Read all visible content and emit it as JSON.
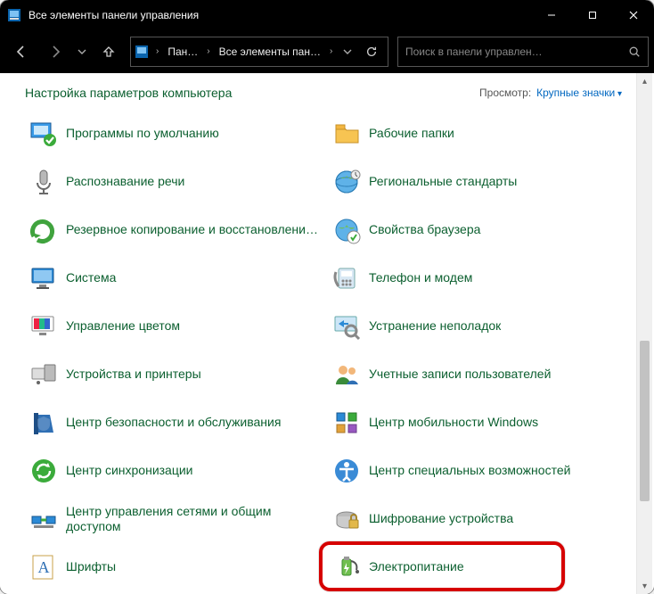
{
  "titlebar": {
    "title": "Все элементы панели управления"
  },
  "breadcrumb": {
    "seg1": "Пан…",
    "seg2": "Все элементы пан…"
  },
  "search": {
    "placeholder": "Поиск в панели управлен…"
  },
  "header": {
    "title": "Настройка параметров компьютера",
    "view_label": "Просмотр:",
    "view_mode": "Крупные значки"
  },
  "items": {
    "left": [
      {
        "label": "Программы по умолчанию",
        "icon": "default-programs-icon"
      },
      {
        "label": "Распознавание речи",
        "icon": "speech-icon"
      },
      {
        "label": "Резервное копирование и восстановлени…",
        "icon": "backup-icon"
      },
      {
        "label": "Система",
        "icon": "system-icon"
      },
      {
        "label": "Управление цветом",
        "icon": "color-icon"
      },
      {
        "label": "Устройства и принтеры",
        "icon": "devices-icon"
      },
      {
        "label": "Центр безопасности и обслуживания",
        "icon": "security-icon"
      },
      {
        "label": "Центр синхронизации",
        "icon": "sync-icon"
      },
      {
        "label": "Центр управления сетями и общим доступом",
        "icon": "network-icon"
      },
      {
        "label": "Шрифты",
        "icon": "fonts-icon"
      }
    ],
    "right": [
      {
        "label": "Рабочие папки",
        "icon": "folders-icon"
      },
      {
        "label": "Региональные стандарты",
        "icon": "region-icon"
      },
      {
        "label": "Свойства браузера",
        "icon": "internet-icon"
      },
      {
        "label": "Телефон и модем",
        "icon": "phone-icon"
      },
      {
        "label": "Устранение неполадок",
        "icon": "troubleshoot-icon"
      },
      {
        "label": "Учетные записи пользователей",
        "icon": "users-icon"
      },
      {
        "label": "Центр мобильности Windows",
        "icon": "mobility-icon"
      },
      {
        "label": "Центр специальных возможностей",
        "icon": "ease-icon"
      },
      {
        "label": "Шифрование устройства",
        "icon": "bitlocker-icon"
      },
      {
        "label": "Электропитание",
        "icon": "power-icon",
        "highlight": true
      }
    ]
  }
}
